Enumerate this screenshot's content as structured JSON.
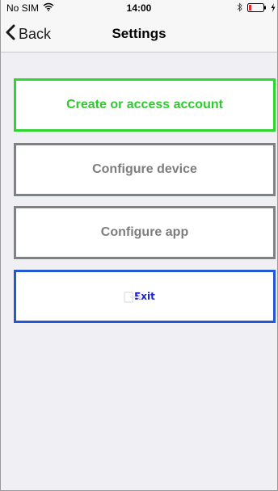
{
  "status_bar": {
    "carrier": "No SIM",
    "time": "14:00",
    "icons": [
      "wifi-icon",
      "bluetooth-icon",
      "battery-icon",
      "charging-icon"
    ]
  },
  "nav": {
    "back_label": "Back",
    "title": "Settings"
  },
  "menu": {
    "account_label": "Create or access account",
    "device_label": "Configure device",
    "app_label": "Configure app",
    "exit_label": "Exit"
  },
  "colors": {
    "background": "#efeff4",
    "account_accent": "#31d531",
    "neutral_border": "#7f8284",
    "exit_accent": "#2457d6",
    "battery_red": "#e0302f"
  }
}
